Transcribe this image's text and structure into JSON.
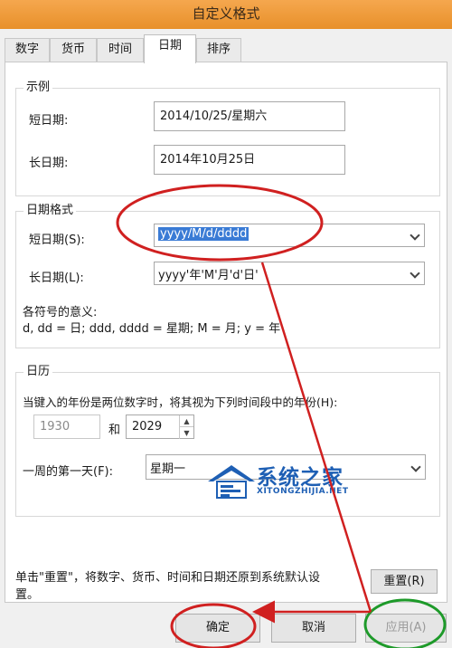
{
  "window": {
    "title": "自定义格式"
  },
  "tabs": [
    {
      "label": "数字"
    },
    {
      "label": "货币"
    },
    {
      "label": "时间"
    },
    {
      "label": "日期"
    },
    {
      "label": "排序"
    }
  ],
  "example": {
    "legend": "示例",
    "short_label": "短日期:",
    "short_value": "2014/10/25/星期六",
    "long_label": "长日期:",
    "long_value": "2014年10月25日"
  },
  "date_format": {
    "legend": "日期格式",
    "short_label": "短日期(S):",
    "short_value": "yyyy/M/d/dddd",
    "long_label": "长日期(L):",
    "long_value": "yyyy'年'M'月'd'日'",
    "symbols_title": "各符号的意义:",
    "symbols_text": "d, dd = 日;  ddd, dddd = 星期;  M = 月;  y = 年"
  },
  "calendar": {
    "legend": "日历",
    "two_digit_text": "当键入的年份是两位数字时，将其视为下列时间段中的年份(H):",
    "year_from": "1930",
    "and_label": "和",
    "year_to": "2029",
    "first_day_label": "一周的第一天(F):",
    "first_day_value": "星期一"
  },
  "reset": {
    "description": "单击\"重置\"，将数字、货币、时间和日期还原到系统默认设置。",
    "description_line1": "单击\"重置\"，将数字、货币、时间和日期还原到系统默认设",
    "description_line2": "置。",
    "button": "重置(R)"
  },
  "buttons": {
    "ok": "确定",
    "cancel": "取消",
    "apply": "应用(A)"
  },
  "watermark": {
    "brand": "系统之家",
    "site": "XITONGZHIJIA.NET"
  },
  "colors": {
    "titlebar": "#e8902a",
    "annotation_red": "#d02020",
    "annotation_green": "#1e9a2a",
    "selection_blue": "#3a7bd5",
    "watermark_blue": "#1e5fb4"
  }
}
